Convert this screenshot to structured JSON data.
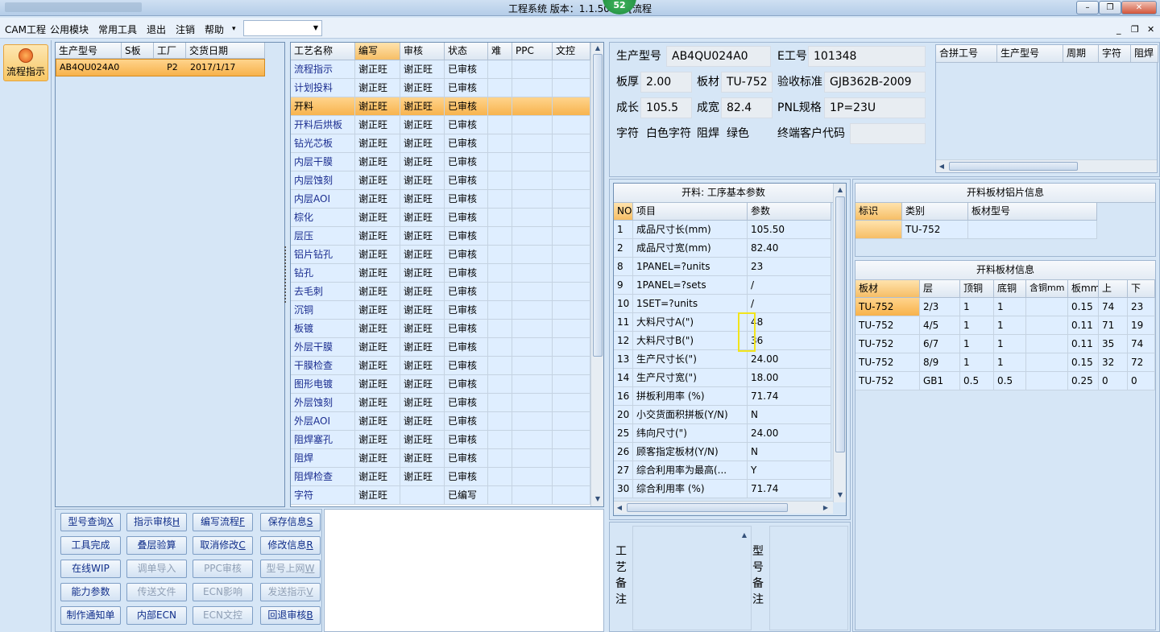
{
  "window": {
    "title": "工程系统  版本：1.1.50.5 - [流程",
    "badge": "52",
    "btn_min": "–",
    "btn_restore": "❐",
    "btn_close": "✕"
  },
  "menu": {
    "items": [
      "CAM工程",
      "公用模块",
      "常用工具",
      "退出",
      "注销",
      "帮助"
    ],
    "dropdown_arrow": "▾",
    "combo_arrow": "▼",
    "mdi": [
      "_",
      "❐",
      "✕"
    ]
  },
  "nav": {
    "flow_button": "流程指示"
  },
  "orders": {
    "headers": [
      "生产型号",
      "S板",
      "工厂",
      "交货日期"
    ],
    "rows": [
      [
        "AB4QU024A0",
        "",
        "P2",
        "2017/1/17"
      ]
    ]
  },
  "flow": {
    "headers": [
      "工艺名称",
      "编写",
      "审核",
      "状态",
      "难",
      "PPC",
      "文控"
    ],
    "rows": [
      [
        "流程指示",
        "谢正旺",
        "谢正旺",
        "已审核"
      ],
      [
        "计划投料",
        "谢正旺",
        "谢正旺",
        "已审核"
      ],
      [
        "开料",
        "谢正旺",
        "谢正旺",
        "已审核"
      ],
      [
        "开料后烘板",
        "谢正旺",
        "谢正旺",
        "已审核"
      ],
      [
        "钻光芯板",
        "谢正旺",
        "谢正旺",
        "已审核"
      ],
      [
        "内层干膜",
        "谢正旺",
        "谢正旺",
        "已审核"
      ],
      [
        "内层蚀刻",
        "谢正旺",
        "谢正旺",
        "已审核"
      ],
      [
        "内层AOI",
        "谢正旺",
        "谢正旺",
        "已审核"
      ],
      [
        "棕化",
        "谢正旺",
        "谢正旺",
        "已审核"
      ],
      [
        "层压",
        "谢正旺",
        "谢正旺",
        "已审核"
      ],
      [
        "铝片钻孔",
        "谢正旺",
        "谢正旺",
        "已审核"
      ],
      [
        "钻孔",
        "谢正旺",
        "谢正旺",
        "已审核"
      ],
      [
        "去毛刺",
        "谢正旺",
        "谢正旺",
        "已审核"
      ],
      [
        "沉铜",
        "谢正旺",
        "谢正旺",
        "已审核"
      ],
      [
        "板镀",
        "谢正旺",
        "谢正旺",
        "已审核"
      ],
      [
        "外层干膜",
        "谢正旺",
        "谢正旺",
        "已审核"
      ],
      [
        "干膜检查",
        "谢正旺",
        "谢正旺",
        "已审核"
      ],
      [
        "图形电镀",
        "谢正旺",
        "谢正旺",
        "已审核"
      ],
      [
        "外层蚀刻",
        "谢正旺",
        "谢正旺",
        "已审核"
      ],
      [
        "外层AOI",
        "谢正旺",
        "谢正旺",
        "已审核"
      ],
      [
        "阻焊塞孔",
        "谢正旺",
        "谢正旺",
        "已审核"
      ],
      [
        "阻焊",
        "谢正旺",
        "谢正旺",
        "已审核"
      ],
      [
        "阻焊检查",
        "谢正旺",
        "谢正旺",
        "已审核"
      ],
      [
        "字符",
        "谢正旺",
        "",
        "已编写"
      ]
    ],
    "selected_index": 2
  },
  "actions": [
    [
      {
        "label": "型号查询",
        "key": "X",
        "enabled": true
      },
      {
        "label": "指示审核",
        "key": "H",
        "enabled": true
      },
      {
        "label": "编写流程",
        "key": "F",
        "enabled": true
      },
      {
        "label": "保存信息",
        "key": "S",
        "enabled": true
      }
    ],
    [
      {
        "label": "工具完成",
        "key": "",
        "enabled": true
      },
      {
        "label": "叠层验算",
        "key": "",
        "enabled": true
      },
      {
        "label": "取消修改",
        "key": "C",
        "enabled": true
      },
      {
        "label": "修改信息",
        "key": "R",
        "enabled": true
      }
    ],
    [
      {
        "label": "在线WIP",
        "key": "",
        "enabled": true
      },
      {
        "label": "调单导入",
        "key": "",
        "enabled": false
      },
      {
        "label": "PPC审核",
        "key": "",
        "enabled": false
      },
      {
        "label": "型号上网",
        "key": "W",
        "enabled": false
      }
    ],
    [
      {
        "label": "能力参数",
        "key": "",
        "enabled": true
      },
      {
        "label": "传送文件",
        "key": "",
        "enabled": false
      },
      {
        "label": "ECN影响",
        "key": "",
        "enabled": false
      },
      {
        "label": "发送指示",
        "key": "V",
        "enabled": false
      }
    ],
    [
      {
        "label": "制作通知单",
        "key": "",
        "enabled": true
      },
      {
        "label": "内部ECN",
        "key": "",
        "enabled": true
      },
      {
        "label": "ECN文控",
        "key": "",
        "enabled": false
      },
      {
        "label": "回退审核",
        "key": "B",
        "enabled": true
      }
    ]
  ],
  "info": {
    "model_label": "生产型号",
    "model": "AB4QU024A0",
    "eno_label": "E工号",
    "eno": "101348",
    "thick_label": "板厚",
    "thick": "2.00",
    "mat_label": "板材",
    "mat": "TU-752",
    "std_label": "验收标准",
    "std": "GJB362B-2009",
    "len_label": "成长",
    "len": "105.5",
    "wid_label": "成宽",
    "wid": "82.4",
    "pnl_label": "PNL规格",
    "pnl": "1P=23U",
    "char_label": "字符",
    "char": "白色字符",
    "mask_label": "阻焊",
    "mask": "绿色",
    "cust_label": "终端客户代码",
    "cust": ""
  },
  "merge": {
    "headers": [
      "合拼工号",
      "生产型号",
      "周期",
      "字符",
      "阻焊"
    ]
  },
  "params": {
    "title": "开料: 工序基本参数",
    "headers": [
      "NO",
      "项目",
      "参数"
    ],
    "rows": [
      [
        "1",
        "成品尺寸长(mm)",
        "105.50"
      ],
      [
        "2",
        "成品尺寸宽(mm)",
        "82.40"
      ],
      [
        "8",
        "1PANEL=?units",
        "23"
      ],
      [
        "9",
        "1PANEL=?sets",
        "/"
      ],
      [
        "10",
        "1SET=?units",
        "/"
      ],
      [
        "11",
        "大料尺寸A(\")",
        "48"
      ],
      [
        "12",
        "大料尺寸B(\")",
        "36"
      ],
      [
        "13",
        "生产尺寸长(\")",
        "24.00"
      ],
      [
        "14",
        "生产尺寸宽(\")",
        "18.00"
      ],
      [
        "16",
        "拼板利用率 (%)",
        "71.74"
      ],
      [
        "20",
        "小交货面积拼板(Y/N)",
        "N"
      ],
      [
        "25",
        "纬向尺寸(\")",
        "24.00"
      ],
      [
        "26",
        "顾客指定板材(Y/N)",
        "N"
      ],
      [
        "27",
        "综合利用率为最高(...",
        "Y"
      ],
      [
        "30",
        "综合利用率 (%)",
        "71.74"
      ]
    ]
  },
  "alu": {
    "title": "开料板材铝片信息",
    "headers": [
      "标识",
      "类别",
      "板材型号"
    ],
    "rows": [
      [
        "",
        "TU-752",
        ""
      ]
    ]
  },
  "boards": {
    "title": "开料板材信息",
    "headers": [
      "板材",
      "层",
      "顶铜",
      "底铜",
      "含铜mm",
      "板mm",
      "上",
      "下"
    ],
    "rows": [
      [
        "TU-752",
        "2/3",
        "1",
        "1",
        "",
        "0.15",
        "74",
        "23"
      ],
      [
        "TU-752",
        "4/5",
        "1",
        "1",
        "",
        "0.11",
        "71",
        "19"
      ],
      [
        "TU-752",
        "6/7",
        "1",
        "1",
        "",
        "0.11",
        "35",
        "74"
      ],
      [
        "TU-752",
        "8/9",
        "1",
        "1",
        "",
        "0.15",
        "32",
        "72"
      ],
      [
        "TU-752",
        "GB1",
        "0.5",
        "0.5",
        "",
        "0.25",
        "0",
        "0"
      ]
    ]
  },
  "notes": {
    "process_label": "工艺备注",
    "model_label": "型号备注"
  },
  "colors": {
    "selected": "#f7b24b",
    "highlight_box": "#f2e41b",
    "row_bg": "#dfeeff"
  }
}
